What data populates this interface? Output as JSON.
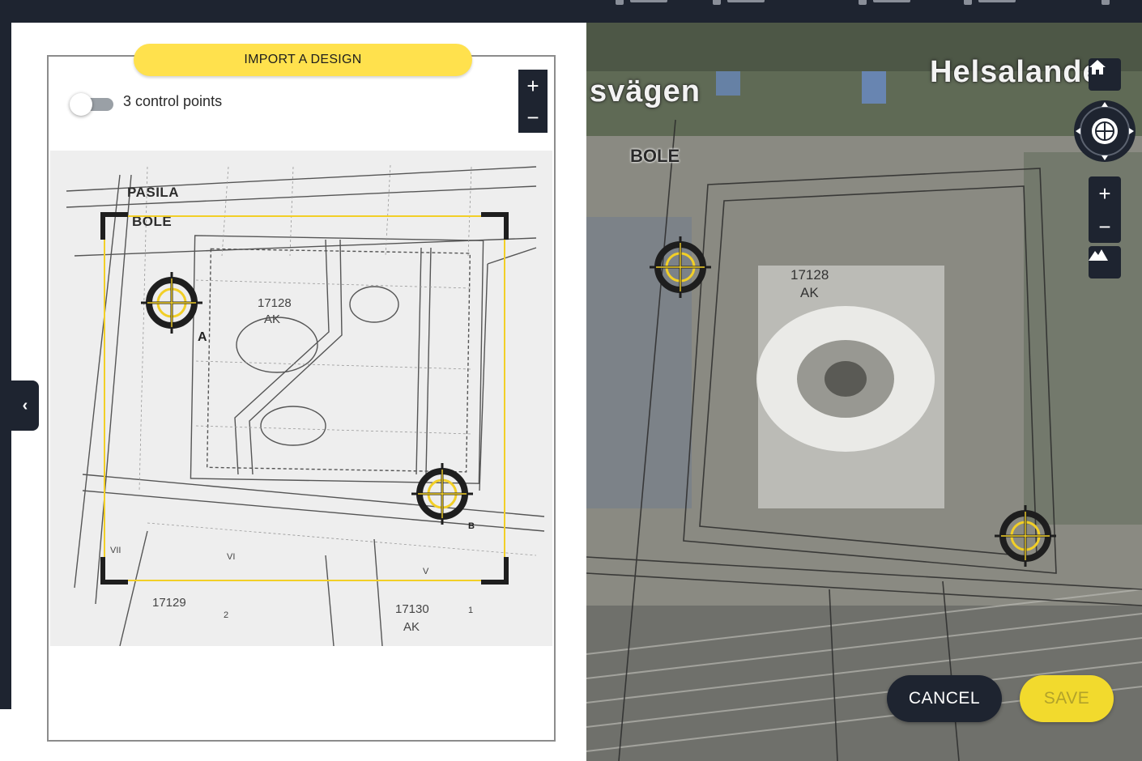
{
  "topbar": {
    "tools": [
      "toolbar-item-1",
      "toolbar-item-2",
      "toolbar-item-3",
      "toolbar-item-4"
    ]
  },
  "panel": {
    "title": "IMPORT A DESIGN",
    "toggle": {
      "label": "3 control points",
      "on": false
    },
    "zoom": {
      "in": "+",
      "out": "−"
    }
  },
  "drawing": {
    "labels": {
      "district1": "PASILA",
      "district2": "BOLE",
      "lot_main": "17128",
      "lot_main_use": "AK",
      "lot_left": "17129",
      "lot_right": "17130",
      "lot_right_use": "AK",
      "plot_num": "2",
      "plot_num_right": "1",
      "zone_vi": "VI",
      "zone_v": "V",
      "zone_vii": "VII"
    },
    "points": {
      "a": "A",
      "b": "B"
    }
  },
  "map": {
    "street_left": "svägen",
    "street_right": "Helsalande",
    "district": "BOLE",
    "lot": "17128",
    "lot_use": "AK",
    "zoom": {
      "in": "+",
      "out": "−"
    }
  },
  "actions": {
    "cancel": "CANCEL",
    "save": "SAVE"
  },
  "colors": {
    "accent": "#ffe14d",
    "dark": "#1e2430",
    "frame": "#f2cf27"
  }
}
